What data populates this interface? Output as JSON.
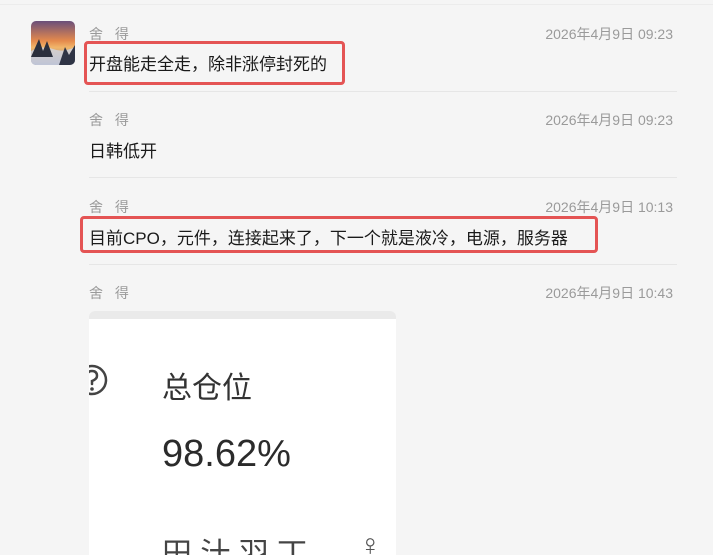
{
  "chat": {
    "messages": [
      {
        "sender": "舍 得",
        "time": "2026年4月9日 09:23",
        "text": "开盘能走全走，除非涨停封死的"
      },
      {
        "sender": "舍 得",
        "time": "2026年4月9日 09:23",
        "text": "日韩低开"
      },
      {
        "sender": "舍 得",
        "time": "2026年4月9日 10:13",
        "text": "目前CPO，元件，连接起来了，下一个就是液冷，电源，服务器"
      },
      {
        "sender": "舍 得",
        "time": "2026年4月9日 10:43",
        "text": ""
      }
    ],
    "image_card": {
      "label": "总仓位",
      "value": "98.62%",
      "partial_text": "田 汁 羽 丁",
      "partial_icon": "♀"
    }
  },
  "colors": {
    "highlight": "#e45454",
    "background": "#f5f5f5",
    "meta_text": "#9a9a9a"
  },
  "icons": [
    "avatar-image",
    "help-icon"
  ]
}
